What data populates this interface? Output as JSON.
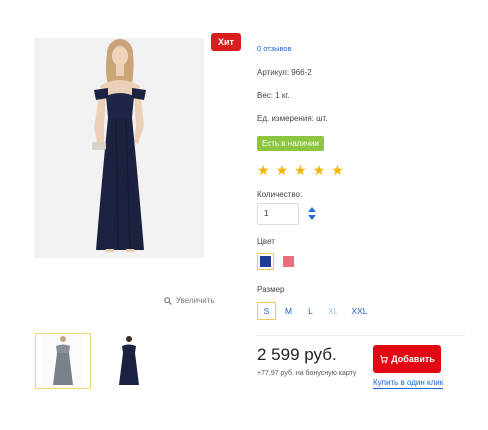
{
  "product": {
    "badge": "Хит",
    "zoom_label": "Увеличить",
    "reviews": "0 отзывов",
    "sku": "Артикул: 966-2",
    "weight": "Вес: 1 кг.",
    "unit": "Ед. измерения: шт.",
    "stock": "Есть в наличии",
    "rating": {
      "filled": 5,
      "max": 5
    },
    "quantity_label": "Количество:",
    "quantity_value": "1",
    "color_label": "Цвет",
    "colors": [
      {
        "name": "navy",
        "hex": "#1f3a93",
        "selected": true
      },
      {
        "name": "coral",
        "hex": "#f06b7c",
        "selected": false
      }
    ],
    "size_label": "Размер",
    "sizes": [
      {
        "label": "S",
        "selected": true,
        "available": true
      },
      {
        "label": "M",
        "selected": false,
        "available": true
      },
      {
        "label": "L",
        "selected": false,
        "available": true
      },
      {
        "label": "XL",
        "selected": false,
        "available": false
      },
      {
        "label": "XXL",
        "selected": false,
        "available": true
      }
    ],
    "price": "2 599 руб.",
    "bonus": "+77,97 руб. на бонусную карту",
    "add_button": "Добавить",
    "one_click": "Купить в один клик"
  },
  "colors": {
    "badge": "#d81e1e",
    "link": "#1a66d2",
    "stock": "#8cc63f",
    "star": "#f5b400",
    "add_button": "#e30613",
    "highlight": "#f0c55a"
  }
}
